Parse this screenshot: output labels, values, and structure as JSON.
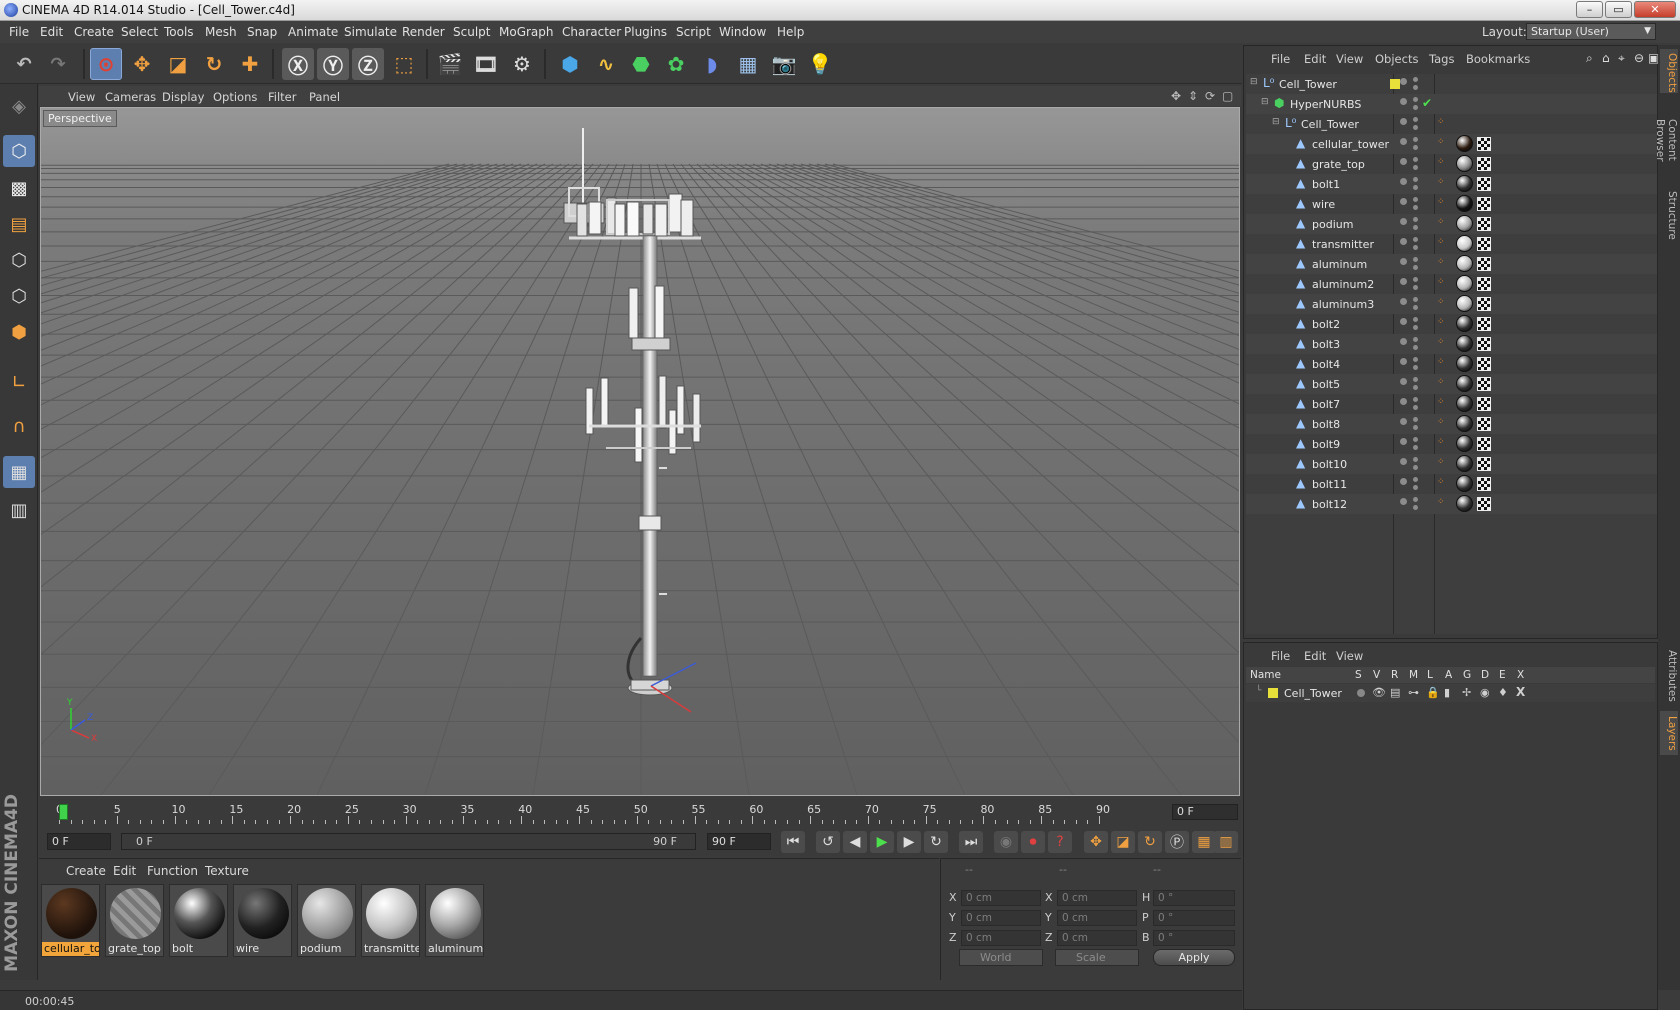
{
  "window": {
    "title": "CINEMA 4D R14.014 Studio - [Cell_Tower.c4d]",
    "min": "–",
    "max": "▭",
    "close": "✕"
  },
  "menu": [
    "File",
    "Edit",
    "Create",
    "Select",
    "Tools",
    "Mesh",
    "Snap",
    "Animate",
    "Simulate",
    "Render",
    "Sculpt",
    "MoGraph",
    "Character",
    "Plugins",
    "Script",
    "Window",
    "Help"
  ],
  "layout": {
    "label": "Layout:",
    "value": "Startup (User)"
  },
  "viewport": {
    "menu": [
      "View",
      "Cameras",
      "Display",
      "Options",
      "Filter",
      "Panel"
    ],
    "label": "Perspective",
    "axes": {
      "x": "X",
      "y": "Y",
      "z": "Z"
    }
  },
  "timeline": {
    "labels": [
      "0",
      "5",
      "10",
      "15",
      "20",
      "25",
      "30",
      "35",
      "40",
      "45",
      "50",
      "55",
      "60",
      "65",
      "70",
      "75",
      "80",
      "85",
      "90"
    ],
    "current_frame": "0 F"
  },
  "transport": {
    "start_field": "0 F",
    "range_start": "0 F",
    "range_end": "90 F",
    "end_field": "90 F"
  },
  "materials": {
    "menu": [
      "Create",
      "Edit",
      "Function",
      "Texture"
    ],
    "items": [
      {
        "name": "cellular_tower",
        "selected": true
      },
      {
        "name": "grate_top"
      },
      {
        "name": "bolt"
      },
      {
        "name": "wire"
      },
      {
        "name": "podium"
      },
      {
        "name": "transmitter"
      },
      {
        "name": "aluminum"
      }
    ]
  },
  "coordinates": {
    "head": [
      "--",
      "--",
      "--"
    ],
    "pos": {
      "X": "0 cm",
      "Y": "0 cm",
      "Z": "0 cm"
    },
    "size": {
      "X": "0 cm",
      "Y": "0 cm",
      "Z": "0 cm"
    },
    "rot": {
      "H": "0 °",
      "P": "0 °",
      "B": "0 °"
    },
    "mode_world": "World",
    "mode_scale": "Scale",
    "apply": "Apply"
  },
  "status": {
    "time": "00:00:45"
  },
  "objects": {
    "menu": [
      "File",
      "Edit",
      "View",
      "Objects",
      "Tags",
      "Bookmarks"
    ],
    "rows": [
      {
        "name": "Cell_Tower",
        "level": 0,
        "type": "null"
      },
      {
        "name": "HyperNURBS",
        "level": 1,
        "type": "nurbs"
      },
      {
        "name": "Cell_Tower",
        "level": 2,
        "type": "null"
      },
      {
        "name": "cellular_tower",
        "level": 3,
        "type": "poly",
        "mat": "#2b1a0e"
      },
      {
        "name": "grate_top",
        "level": 3,
        "type": "poly",
        "mat": "#8a8a8a"
      },
      {
        "name": "bolt1",
        "level": 3,
        "type": "poly",
        "mat": "#303030"
      },
      {
        "name": "wire",
        "level": 3,
        "type": "poly",
        "mat": "#151515"
      },
      {
        "name": "podium",
        "level": 3,
        "type": "poly",
        "mat": "#a0a0a0"
      },
      {
        "name": "transmitter",
        "level": 3,
        "type": "poly",
        "mat": "#c8c8c8"
      },
      {
        "name": "aluminum",
        "level": 3,
        "type": "poly",
        "mat": "#b5b5b5"
      },
      {
        "name": "aluminum2",
        "level": 3,
        "type": "poly",
        "mat": "#b5b5b5"
      },
      {
        "name": "aluminum3",
        "level": 3,
        "type": "poly",
        "mat": "#b5b5b5"
      },
      {
        "name": "bolt2",
        "level": 3,
        "type": "poly",
        "mat": "#303030"
      },
      {
        "name": "bolt3",
        "level": 3,
        "type": "poly",
        "mat": "#303030"
      },
      {
        "name": "bolt4",
        "level": 3,
        "type": "poly",
        "mat": "#303030"
      },
      {
        "name": "bolt5",
        "level": 3,
        "type": "poly",
        "mat": "#303030"
      },
      {
        "name": "bolt7",
        "level": 3,
        "type": "poly",
        "mat": "#303030"
      },
      {
        "name": "bolt8",
        "level": 3,
        "type": "poly",
        "mat": "#303030"
      },
      {
        "name": "bolt9",
        "level": 3,
        "type": "poly",
        "mat": "#303030"
      },
      {
        "name": "bolt10",
        "level": 3,
        "type": "poly",
        "mat": "#303030"
      },
      {
        "name": "bolt11",
        "level": 3,
        "type": "poly",
        "mat": "#303030"
      },
      {
        "name": "bolt12",
        "level": 3,
        "type": "poly",
        "mat": "#303030"
      }
    ]
  },
  "side_tabs": [
    "Objects",
    "Content Browser",
    "Structure",
    "Attributes",
    "Layers"
  ],
  "layers": {
    "menu": [
      "File",
      "Edit",
      "View"
    ],
    "columns": [
      "Name",
      "S",
      "V",
      "R",
      "M",
      "L",
      "A",
      "G",
      "D",
      "E",
      "X"
    ],
    "rows": [
      {
        "name": "Cell_Tower",
        "color": "#e8e03a"
      }
    ]
  },
  "colors": {
    "accent": "#5d7fb0",
    "selected_material": "#f2a53a",
    "layer": "#e8e03a"
  }
}
